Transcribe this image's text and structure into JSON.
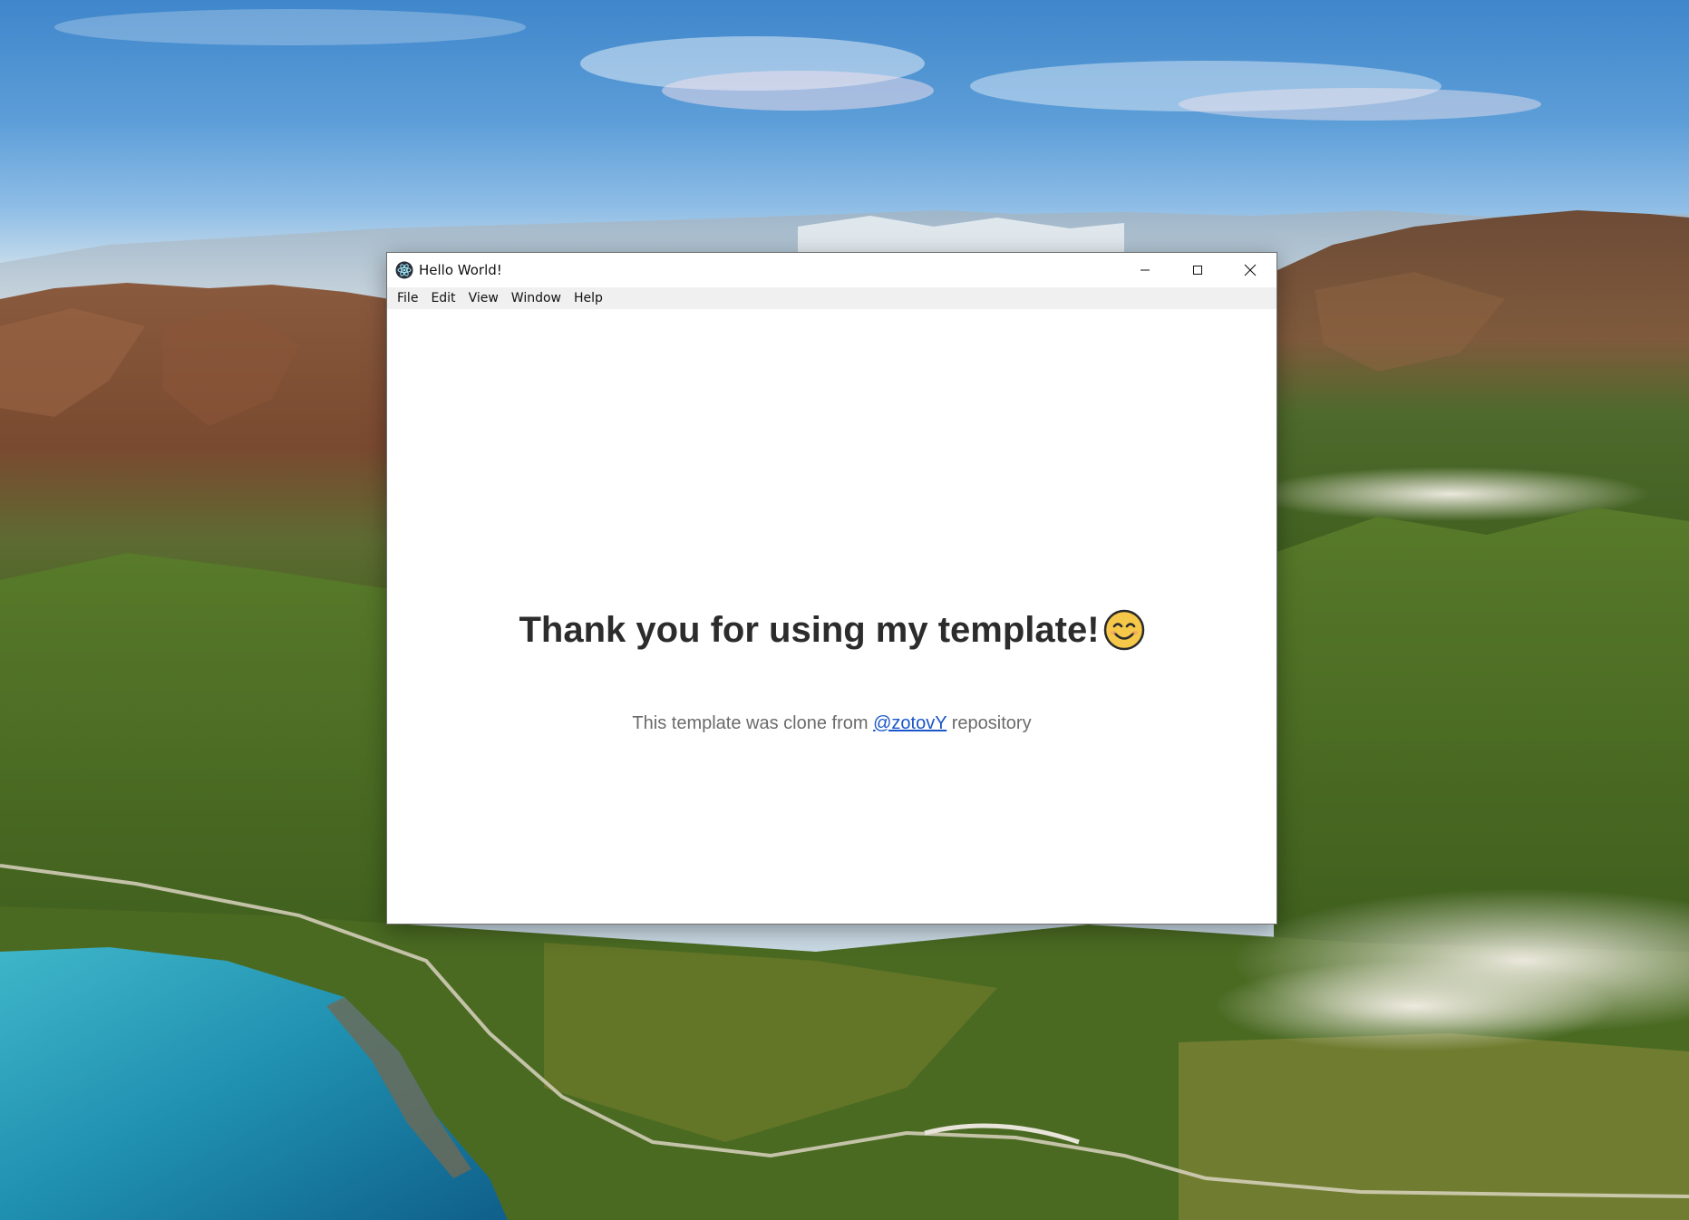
{
  "window": {
    "title": "Hello World!",
    "app_icon": "electron-atom-icon",
    "controls": {
      "minimize": "minimize-icon",
      "maximize": "maximize-icon",
      "close": "close-icon"
    }
  },
  "menubar": {
    "items": [
      {
        "label": "File"
      },
      {
        "label": "Edit"
      },
      {
        "label": "View"
      },
      {
        "label": "Window"
      },
      {
        "label": "Help"
      }
    ]
  },
  "main": {
    "headline": "Thank you for using my template!",
    "headline_emoji": "smiling-face-icon",
    "subline_prefix": "This template was clone from",
    "link_text": "@zotovY",
    "subline_suffix": "repository"
  },
  "colors": {
    "link": "#1a56c9",
    "headline": "#2c2c2c",
    "subtext": "#6b6b6b",
    "menubar_bg": "#f0f0f0",
    "emoji_fill": "#f6c84a"
  }
}
